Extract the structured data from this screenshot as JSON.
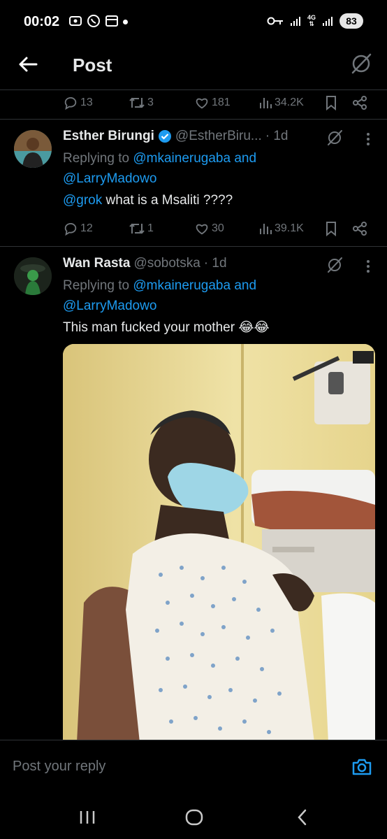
{
  "status_bar": {
    "time": "00:02",
    "network": "4G",
    "battery": "83"
  },
  "header": {
    "title": "Post"
  },
  "top_actions": {
    "replies": "13",
    "reposts": "3",
    "likes": "181",
    "views": "34.2K"
  },
  "tweets": [
    {
      "name": "Esther Birungi",
      "handle": "@EstherBiru...",
      "time": "· 1d",
      "replying_prefix": "Replying to ",
      "replying_user1": "@mkainerugaba",
      "replying_and": " and",
      "replying_user2": "@LarryMadowo",
      "mention": "@grok",
      "text": " what is a Msaliti ????",
      "replies": "12",
      "reposts": "1",
      "likes": "30",
      "views": "39.1K"
    },
    {
      "name": "Wan Rasta",
      "handle": "@sobotska",
      "time": "· 1d",
      "replying_prefix": "Replying to ",
      "replying_user1": "@mkainerugaba",
      "replying_and": " and",
      "replying_user2": "@LarryMadowo",
      "text": "This man fucked your mother 😂😂"
    }
  ],
  "reply_bar": {
    "placeholder": "Post your reply"
  },
  "colors": {
    "accent": "#1d9bf0",
    "muted": "#71767b",
    "text": "#e7e9ea",
    "background": "#000000"
  }
}
